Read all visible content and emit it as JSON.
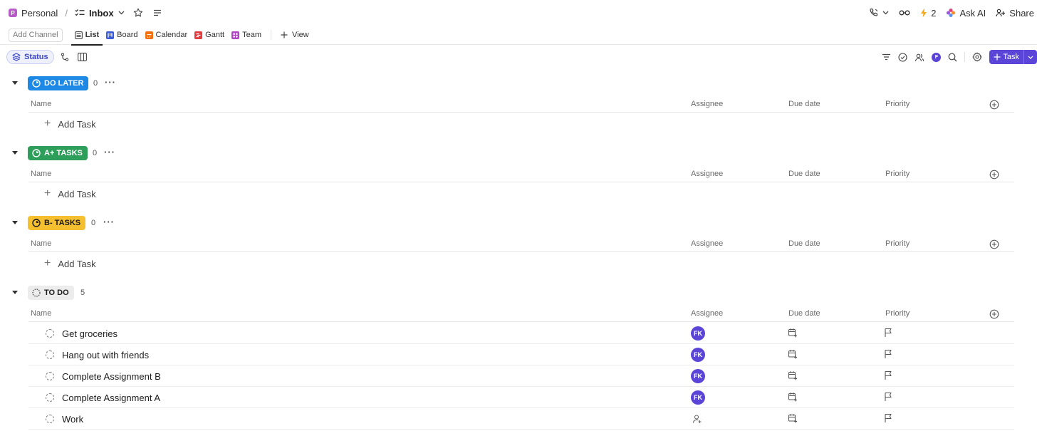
{
  "breadcrumb": {
    "space_badge": "P",
    "space": "Personal",
    "separator": "/",
    "list": "Inbox"
  },
  "topbar": {
    "notif_count": "2",
    "ask_ai": "Ask AI",
    "share": "Share"
  },
  "views": {
    "add_channel": "Add Channel",
    "tabs": [
      {
        "label": "List",
        "active": true,
        "color": "#5a5a5a"
      },
      {
        "label": "Board",
        "active": false,
        "color": "#3b5bdb"
      },
      {
        "label": "Calendar",
        "active": false,
        "color": "#f2700f"
      },
      {
        "label": "Gantt",
        "active": false,
        "color": "#e03e3e"
      },
      {
        "label": "Team",
        "active": false,
        "color": "#b045c4"
      }
    ],
    "add_view": "View"
  },
  "toolbar": {
    "status_chip": "Status",
    "user_avatar": "F",
    "task_button": "Task"
  },
  "columns": {
    "name": "Name",
    "assignee": "Assignee",
    "due_date": "Due date",
    "priority": "Priority"
  },
  "add_task_label": "Add Task",
  "groups": [
    {
      "label": "DO LATER",
      "count": "0",
      "bg": "#1e88e5",
      "fg": "#ffffff"
    },
    {
      "label": "A+ TASKS",
      "count": "0",
      "bg": "#2e9e5b",
      "fg": "#ffffff"
    },
    {
      "label": "B- TASKS",
      "count": "0",
      "bg": "#f5c02f",
      "fg": "#1a1a1a"
    },
    {
      "label": "TO DO",
      "count": "5",
      "bg": "#ececec",
      "fg": "#1a1a1a"
    }
  ],
  "tasks": [
    {
      "name": "Get groceries",
      "assignee": "FK"
    },
    {
      "name": "Hang out with friends",
      "assignee": "FK"
    },
    {
      "name": "Complete Assignment B",
      "assignee": "FK"
    },
    {
      "name": "Complete Assignment A",
      "assignee": "FK"
    },
    {
      "name": "Work",
      "assignee": ""
    }
  ]
}
